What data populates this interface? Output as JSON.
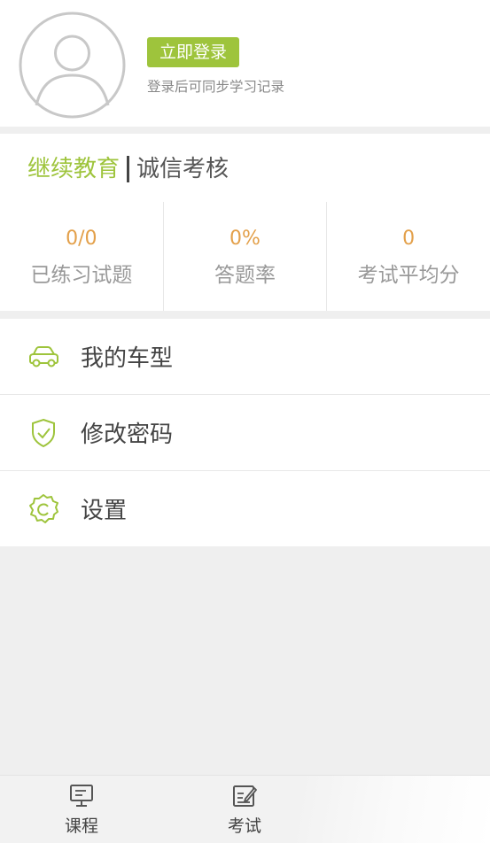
{
  "profile": {
    "login_button": "立即登录",
    "login_hint": "登录后可同步学习记录"
  },
  "stats_tabs": [
    {
      "label": "继续教育",
      "active": true
    },
    {
      "label": "诚信考核",
      "active": false
    }
  ],
  "stats": [
    {
      "value": "0/0",
      "label": "已练习试题"
    },
    {
      "value": "0%",
      "label": "答题率"
    },
    {
      "value": "0",
      "label": "考试平均分"
    }
  ],
  "menu": [
    {
      "label": "我的车型",
      "icon": "car-icon"
    },
    {
      "label": "修改密码",
      "icon": "shield-check-icon"
    },
    {
      "label": "设置",
      "icon": "settings-gear-icon"
    }
  ],
  "tabbar": [
    {
      "label": "课程",
      "icon": "course-monitor-icon"
    },
    {
      "label": "考试",
      "icon": "exam-edit-icon"
    }
  ],
  "colors": {
    "accent": "#9ec43c",
    "stat_value": "#e3a04a",
    "background": "#efefef"
  }
}
